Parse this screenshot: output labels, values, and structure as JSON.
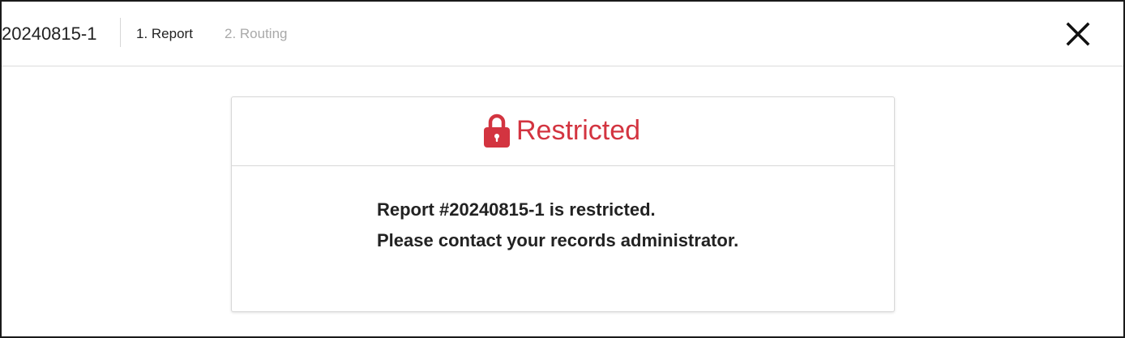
{
  "header": {
    "record_id": "20240815-1",
    "steps": [
      {
        "label": "1. Report",
        "state": "active"
      },
      {
        "label": "2. Routing",
        "state": "disabled"
      }
    ],
    "close_icon": "close-icon"
  },
  "card": {
    "icon": "lock-icon",
    "title": "Restricted",
    "title_color": "#d33440",
    "message_lines": [
      "Report #20240815-1 is restricted.",
      "Please contact your records administrator."
    ]
  }
}
